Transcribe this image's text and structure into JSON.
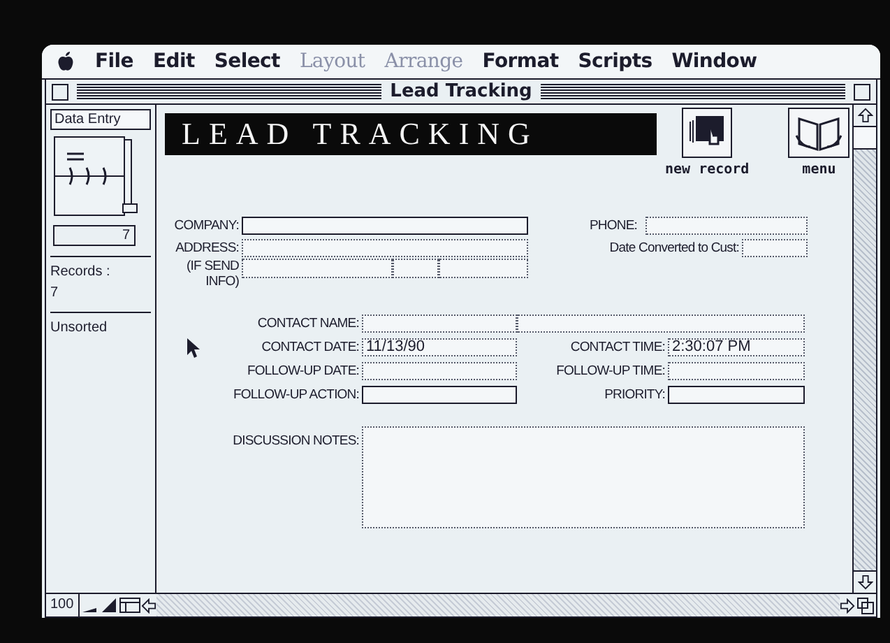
{
  "menu_bar": {
    "items": [
      {
        "label": "File",
        "disabled": false
      },
      {
        "label": "Edit",
        "disabled": false
      },
      {
        "label": "Select",
        "disabled": false
      },
      {
        "label": "Layout",
        "disabled": true
      },
      {
        "label": "Arrange",
        "disabled": true
      },
      {
        "label": "Format",
        "disabled": false
      },
      {
        "label": "Scripts",
        "disabled": false
      },
      {
        "label": "Window",
        "disabled": false
      }
    ]
  },
  "window": {
    "title": "Lead Tracking"
  },
  "sidebar": {
    "mode": "Data Entry",
    "record_number": "7",
    "records_label": "Records :",
    "records_count": "7",
    "sort_status": "Unsorted"
  },
  "header": {
    "title": "LEAD TRACKING",
    "buttons": [
      {
        "label": "new record",
        "kind": "new"
      },
      {
        "label": "menu",
        "kind": "menu"
      }
    ]
  },
  "company": {
    "company_label": "COMPANY:",
    "address_label": "ADDRESS:",
    "address_note": "(IF SEND INFO)",
    "phone_label": "PHONE:",
    "converted_label": "Date Converted to Cust:"
  },
  "contact_rows": [
    {
      "left": {
        "label": "CONTACT NAME:",
        "kind": "dotted",
        "split": true
      }
    },
    {
      "left": {
        "label": "CONTACT DATE:",
        "kind": "dotted",
        "value": "11/13/90"
      },
      "right": {
        "label": "CONTACT TIME:",
        "kind": "dotted",
        "value": "2:30:07 PM"
      }
    },
    {
      "left": {
        "label": "FOLLOW-UP DATE:",
        "kind": "dotted"
      },
      "right": {
        "label": "FOLLOW-UP TIME:",
        "kind": "dotted"
      }
    },
    {
      "left": {
        "label": "FOLLOW-UP ACTION:",
        "kind": "solid"
      },
      "right": {
        "label": "PRIORITY:",
        "kind": "solid"
      }
    }
  ],
  "notes": {
    "label": "DISCUSSION NOTES:"
  },
  "status_bar": {
    "zoom": "100"
  }
}
